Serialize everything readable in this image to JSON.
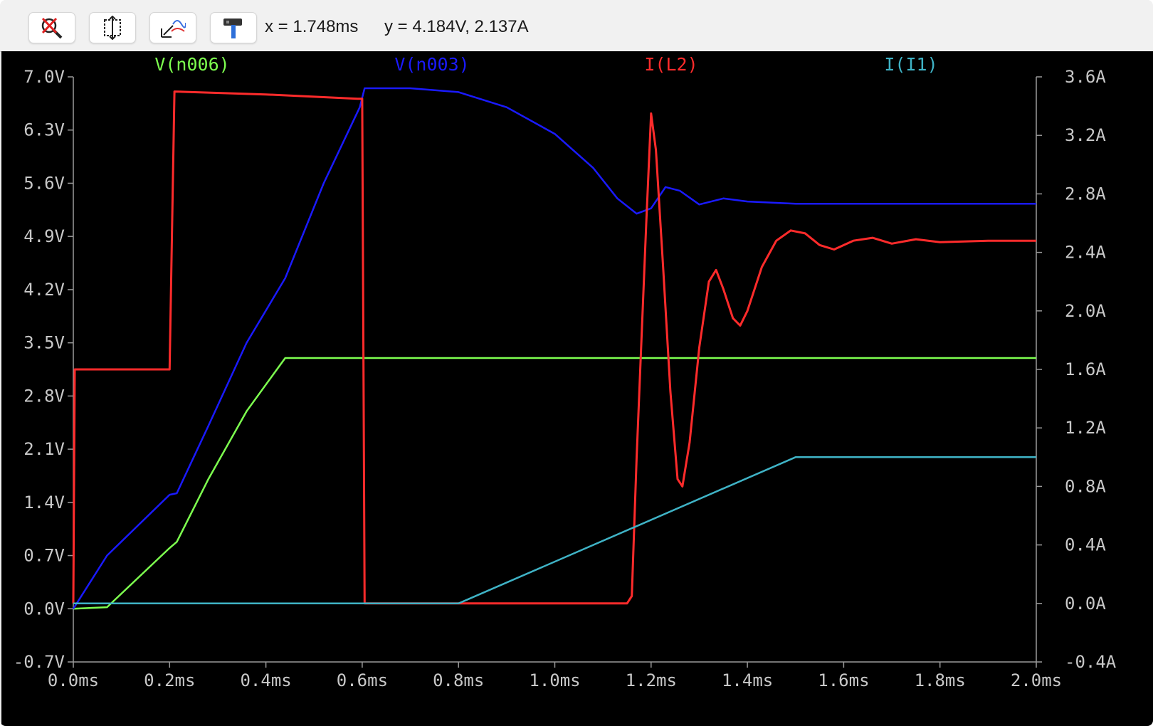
{
  "toolbar": {
    "buttons": [
      {
        "name": "zoom-cancel",
        "icon": "zoom-cancel-icon"
      },
      {
        "name": "autorange",
        "icon": "autorange-icon"
      },
      {
        "name": "pan-view",
        "icon": "waveform-pan-icon"
      },
      {
        "name": "settings",
        "icon": "hammer-icon"
      }
    ],
    "cursor_x": "x = 1.748ms",
    "cursor_y": "y = 4.184V, 2.137A"
  },
  "colors": {
    "background": "#000000",
    "axis": "#9a9a9a",
    "tick_label": "#c8c8c8",
    "v_n006": "#7dff4f",
    "v_n003": "#1a1aff",
    "i_l2": "#ff2b2b",
    "i_i1": "#3fb3c6"
  },
  "chart_data": {
    "type": "line",
    "xlabel": "",
    "xlim": [
      0,
      2.0
    ],
    "x_ticks": [
      "0.0ms",
      "0.2ms",
      "0.4ms",
      "0.6ms",
      "0.8ms",
      "1.0ms",
      "1.2ms",
      "1.4ms",
      "1.6ms",
      "1.8ms",
      "2.0ms"
    ],
    "x_tick_values": [
      0,
      0.2,
      0.4,
      0.6,
      0.8,
      1.0,
      1.2,
      1.4,
      1.6,
      1.8,
      2.0
    ],
    "y_left": {
      "lim": [
        -0.7,
        7.0
      ],
      "ticks": [
        "7.0V",
        "6.3V",
        "5.6V",
        "4.9V",
        "4.2V",
        "3.5V",
        "2.8V",
        "2.1V",
        "1.4V",
        "0.7V",
        "0.0V",
        "-0.7V"
      ],
      "tick_values": [
        7.0,
        6.3,
        5.6,
        4.9,
        4.2,
        3.5,
        2.8,
        2.1,
        1.4,
        0.7,
        0.0,
        -0.7
      ]
    },
    "y_right": {
      "lim": [
        -0.4,
        3.6
      ],
      "ticks": [
        "3.6A",
        "3.2A",
        "2.8A",
        "2.4A",
        "2.0A",
        "1.6A",
        "1.2A",
        "0.8A",
        "0.4A",
        "0.0A",
        "-0.4A"
      ],
      "tick_values": [
        3.6,
        3.2,
        2.8,
        2.4,
        2.0,
        1.6,
        1.2,
        0.8,
        0.4,
        0.0,
        -0.4
      ]
    },
    "grid": false,
    "legend": "top",
    "series": [
      {
        "name": "V(n006)",
        "axis": "left",
        "color": "#7dff4f",
        "points": [
          [
            0,
            0.0
          ],
          [
            0.07,
            0.02
          ],
          [
            0.2,
            0.8
          ],
          [
            0.215,
            0.88
          ],
          [
            0.28,
            1.7
          ],
          [
            0.36,
            2.6
          ],
          [
            0.44,
            3.3
          ],
          [
            2.0,
            3.3
          ]
        ]
      },
      {
        "name": "V(n003)",
        "axis": "left",
        "color": "#1a1aff",
        "points": [
          [
            0,
            0.0
          ],
          [
            0.07,
            0.7
          ],
          [
            0.2,
            1.5
          ],
          [
            0.215,
            1.52
          ],
          [
            0.28,
            2.4
          ],
          [
            0.36,
            3.5
          ],
          [
            0.44,
            4.35
          ],
          [
            0.52,
            5.6
          ],
          [
            0.595,
            6.6
          ],
          [
            0.605,
            6.85
          ],
          [
            0.7,
            6.85
          ],
          [
            0.8,
            6.8
          ],
          [
            0.9,
            6.6
          ],
          [
            1.0,
            6.25
          ],
          [
            1.08,
            5.8
          ],
          [
            1.13,
            5.4
          ],
          [
            1.17,
            5.2
          ],
          [
            1.2,
            5.27
          ],
          [
            1.23,
            5.55
          ],
          [
            1.26,
            5.5
          ],
          [
            1.3,
            5.32
          ],
          [
            1.35,
            5.4
          ],
          [
            1.4,
            5.36
          ],
          [
            1.5,
            5.33
          ],
          [
            2.0,
            5.33
          ]
        ]
      },
      {
        "name": "I(L2)",
        "axis": "right",
        "color": "#ff2b2b",
        "points": [
          [
            0,
            0.0
          ],
          [
            0.003,
            1.6
          ],
          [
            0.2,
            1.6
          ],
          [
            0.21,
            3.5
          ],
          [
            0.4,
            3.48
          ],
          [
            0.59,
            3.45
          ],
          [
            0.6,
            3.45
          ],
          [
            0.605,
            0.0
          ],
          [
            1.15,
            0.0
          ],
          [
            1.16,
            0.05
          ],
          [
            1.17,
            1.0
          ],
          [
            1.19,
            2.6
          ],
          [
            1.2,
            3.35
          ],
          [
            1.21,
            3.1
          ],
          [
            1.225,
            2.3
          ],
          [
            1.24,
            1.45
          ],
          [
            1.255,
            0.85
          ],
          [
            1.265,
            0.8
          ],
          [
            1.28,
            1.1
          ],
          [
            1.3,
            1.75
          ],
          [
            1.32,
            2.2
          ],
          [
            1.335,
            2.28
          ],
          [
            1.35,
            2.15
          ],
          [
            1.37,
            1.95
          ],
          [
            1.385,
            1.9
          ],
          [
            1.4,
            2.0
          ],
          [
            1.43,
            2.3
          ],
          [
            1.46,
            2.48
          ],
          [
            1.49,
            2.55
          ],
          [
            1.52,
            2.53
          ],
          [
            1.55,
            2.45
          ],
          [
            1.58,
            2.42
          ],
          [
            1.62,
            2.48
          ],
          [
            1.66,
            2.5
          ],
          [
            1.7,
            2.46
          ],
          [
            1.75,
            2.49
          ],
          [
            1.8,
            2.47
          ],
          [
            1.9,
            2.48
          ],
          [
            2.0,
            2.48
          ]
        ]
      },
      {
        "name": "I(I1)",
        "axis": "right",
        "color": "#3fb3c6",
        "points": [
          [
            0,
            0.0
          ],
          [
            0.8,
            0.0
          ],
          [
            1.5,
            1.0
          ],
          [
            2.0,
            1.0
          ]
        ]
      }
    ]
  }
}
